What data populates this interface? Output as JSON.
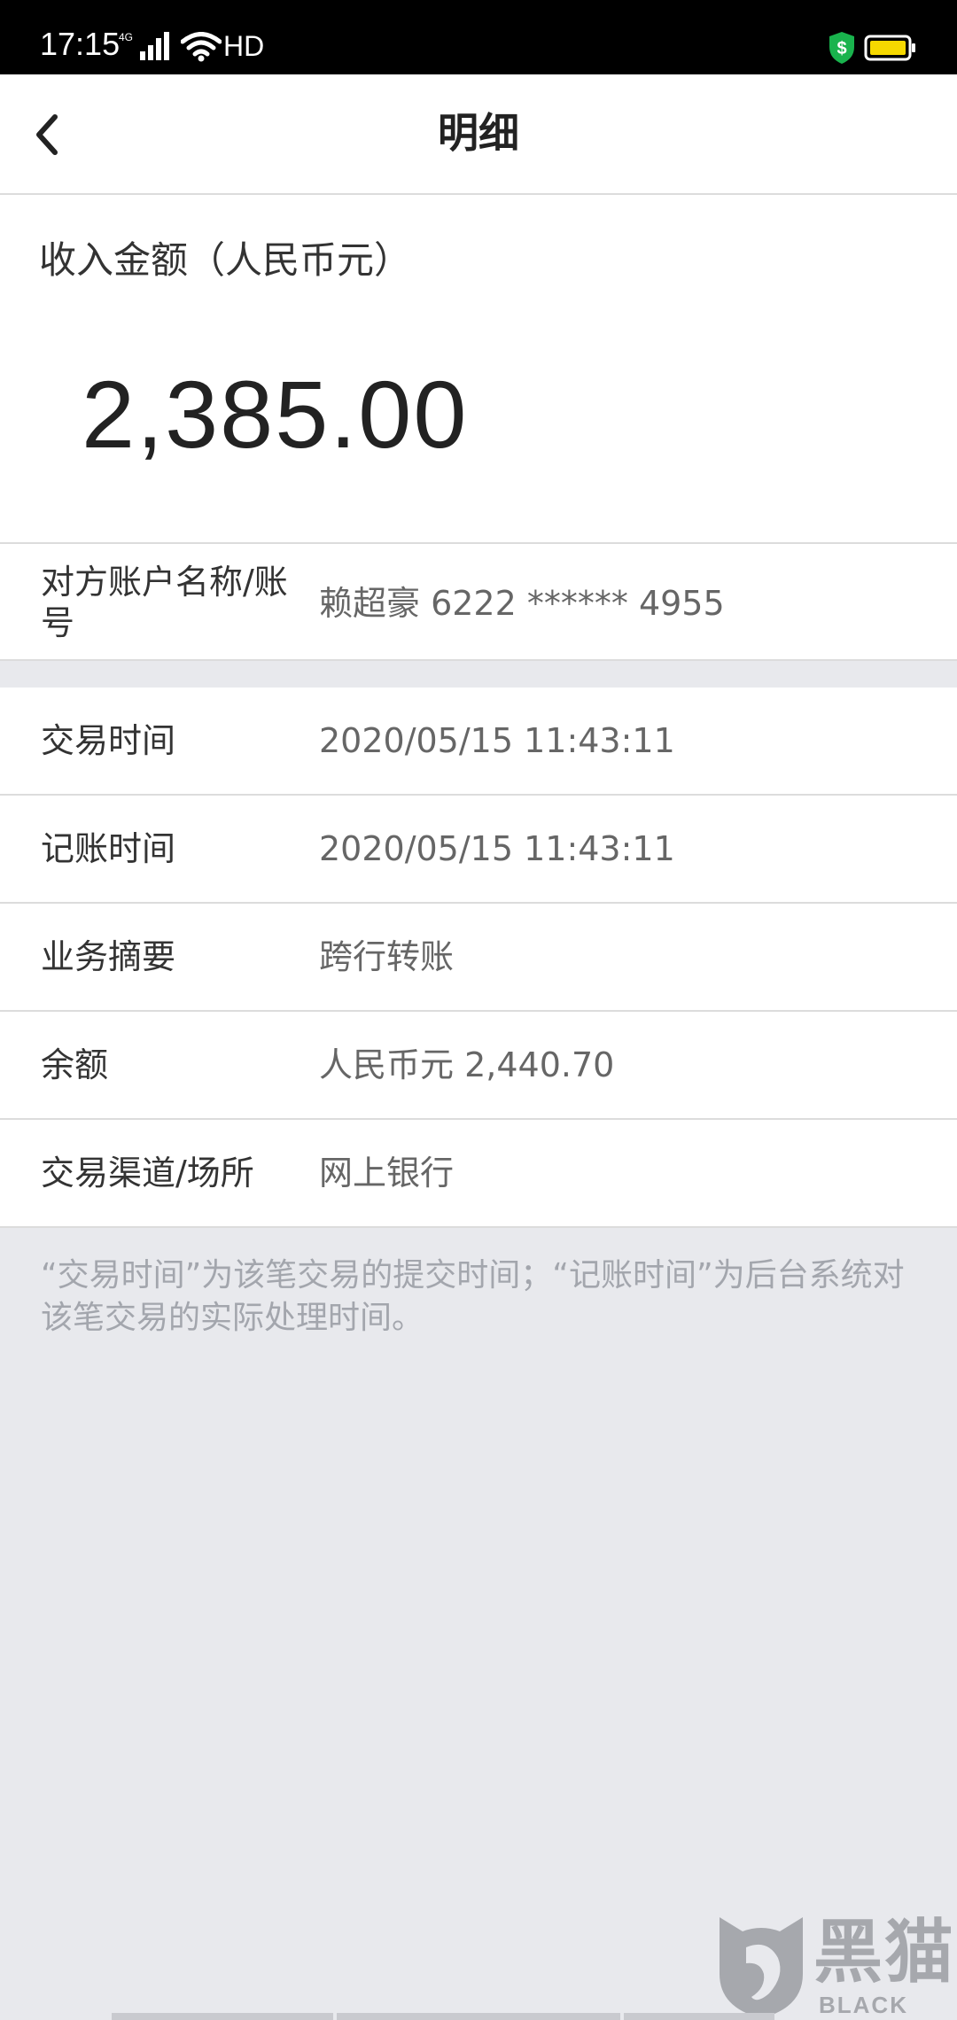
{
  "status_bar": {
    "time": "17:15",
    "network": "4G",
    "hd": "HD",
    "battery_color": "#f5d800",
    "shield_color": "#19b34d"
  },
  "nav": {
    "title": "明细"
  },
  "amount": {
    "label": "收入金额（人民币元）",
    "value": "2,385.00"
  },
  "counterparty": {
    "label": "对方账户名称/账号",
    "value": "赖超豪 6222 ****** 4955"
  },
  "details": [
    {
      "label": "交易时间",
      "value": "2020/05/15  11:43:11"
    },
    {
      "label": "记账时间",
      "value": "2020/05/15  11:43:11"
    },
    {
      "label": "业务摘要",
      "value": "跨行转账"
    },
    {
      "label": "余额",
      "value": "人民币元 2,440.70"
    },
    {
      "label": "交易渠道/场所",
      "value": "网上银行"
    }
  ],
  "footnote": "“交易时间”为该笔交易的提交时间；“记账时间”为后台系统对该笔交易的实际处理时间。",
  "watermark": {
    "text": "黑猫",
    "subtext": "BLACK CAT"
  },
  "colors": {
    "background": "#e8e9ed",
    "card": "#ffffff",
    "divider": "#dcdcdc",
    "label_text": "#333333",
    "value_text": "#666666",
    "footnote_text": "#a3a6ad"
  }
}
